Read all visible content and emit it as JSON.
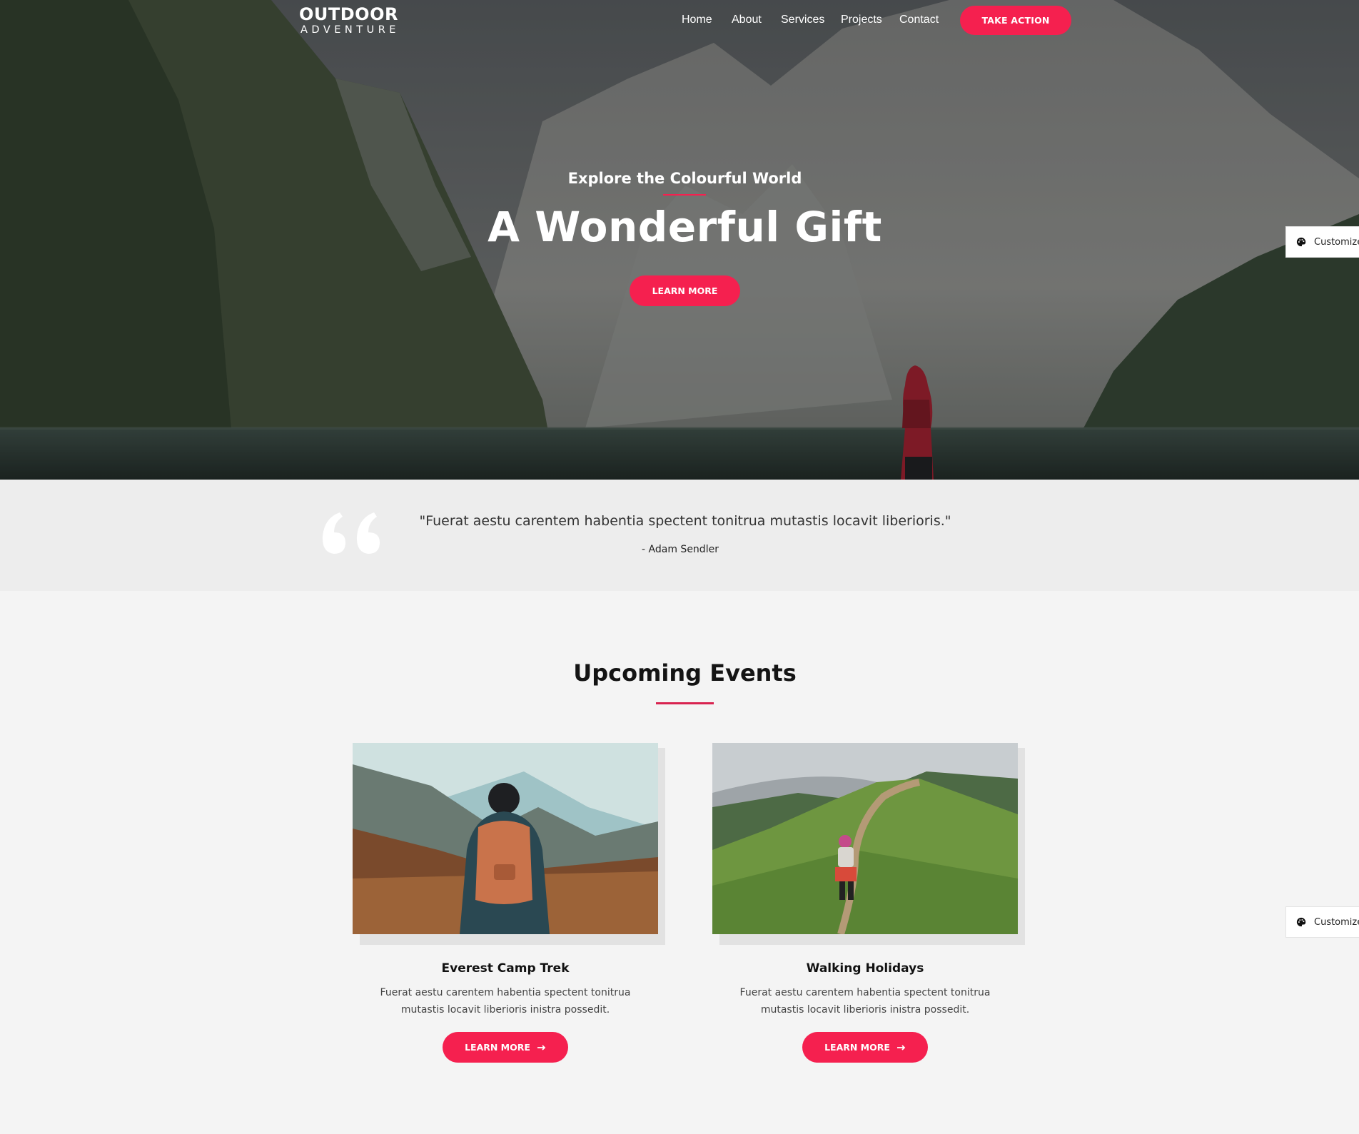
{
  "brand": {
    "line1": "OUTDOOR",
    "line2": "ADVENTURE"
  },
  "nav": {
    "items": [
      {
        "label": "Home"
      },
      {
        "label": "About"
      },
      {
        "label": "Services"
      },
      {
        "label": "Projects"
      },
      {
        "label": "Contact"
      }
    ],
    "cta_label": "TAKE ACTION"
  },
  "hero": {
    "subtitle": "Explore the Colourful World",
    "title": "A Wonderful Gift",
    "button_label": "LEARN MORE"
  },
  "customize": {
    "label": "Customize"
  },
  "quote": {
    "text": "\"Fuerat aestu carentem habentia spectent tonitrua mutastis locavit liberioris.\"",
    "author": "- Adam Sendler"
  },
  "events": {
    "title": "Upcoming Events",
    "cards": [
      {
        "title": "Everest Camp Trek",
        "description": "Fuerat aestu carentem habentia spectent tonitrua mutastis locavit liberioris inistra possedit.",
        "button_label": "LEARN MORE"
      },
      {
        "title": "Walking Holidays",
        "description": "Fuerat aestu carentem habentia spectent tonitrua mutastis locavit liberioris inistra possedit.",
        "button_label": "LEARN MORE"
      }
    ]
  },
  "colors": {
    "accent": "#f5204f",
    "quote_bg": "#ededed",
    "page_bg": "#f4f4f4"
  },
  "icons": {
    "customize": "palette-icon",
    "quote": "quote-icon",
    "arrow": "arrow-right-icon"
  }
}
